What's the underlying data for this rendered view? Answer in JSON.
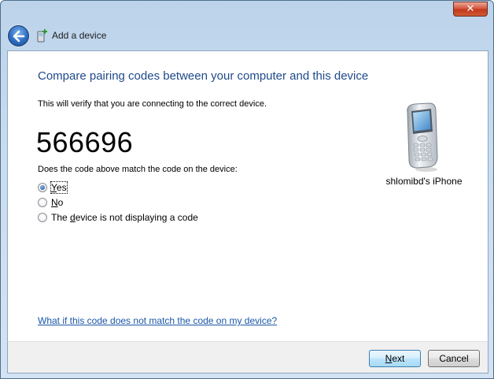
{
  "window": {
    "title": "Add a device",
    "close_glyph": "✕"
  },
  "main": {
    "heading": "Compare pairing codes between your computer and this device",
    "subtitle": "This will verify that you are connecting to the correct device.",
    "code": "566696",
    "question": "Does the code above match the code on the device:",
    "options": [
      {
        "label_prefix": "",
        "label_underlined": "Y",
        "label_rest": "es",
        "checked": true
      },
      {
        "label_prefix": "",
        "label_underlined": "N",
        "label_rest": "o",
        "checked": false
      },
      {
        "label_prefix": "The ",
        "label_underlined": "d",
        "label_rest": "evice is not displaying a code",
        "checked": false
      }
    ],
    "help_link": "What if this code does not match the code on my device?"
  },
  "device": {
    "name": "shlomibd's iPhone",
    "icon": "mobile-phone-icon"
  },
  "footer": {
    "next_prefix": "",
    "next_underlined": "N",
    "next_rest": "ext",
    "cancel_label": "Cancel"
  },
  "colors": {
    "heading": "#1f4a8a",
    "link": "#1a56a8",
    "close_button": "#c1391d"
  }
}
